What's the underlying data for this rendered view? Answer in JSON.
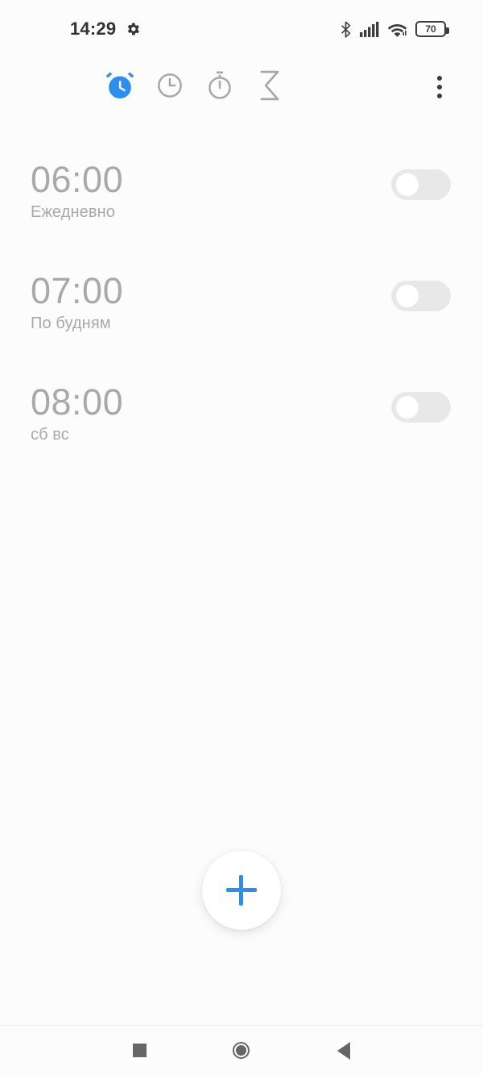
{
  "status_bar": {
    "time": "14:29",
    "gear_icon": "gear-icon",
    "bluetooth_icon": "bluetooth-icon",
    "signal_icon": "cellular-signal-icon",
    "wifi_icon": "wifi-icon",
    "battery_level": "70"
  },
  "tabs": [
    {
      "name": "alarm",
      "icon": "alarm-clock-icon",
      "active": true
    },
    {
      "name": "world-clock",
      "icon": "clock-icon",
      "active": false
    },
    {
      "name": "stopwatch",
      "icon": "stopwatch-icon",
      "active": false
    },
    {
      "name": "timer",
      "icon": "hourglass-icon",
      "active": false
    }
  ],
  "overflow_menu": {
    "icon": "more-vertical-icon"
  },
  "alarms": [
    {
      "time": "06:00",
      "repeat": "Ежедневно",
      "enabled": false
    },
    {
      "time": "07:00",
      "repeat": "По будням",
      "enabled": false
    },
    {
      "time": "08:00",
      "repeat": "сб вс",
      "enabled": false
    }
  ],
  "fab": {
    "icon": "plus-icon"
  },
  "nav_bar": {
    "recents_icon": "square-recents-icon",
    "home_icon": "circle-home-icon",
    "back_icon": "triangle-back-icon"
  },
  "colors": {
    "accent": "#2e8ef0",
    "tab_active": "#2e8ef0",
    "tab_inactive": "#a8a8a8",
    "text_muted": "#a9a9a9",
    "background": "#fcfcfc",
    "toggle_off_track": "#e8e8e8"
  }
}
